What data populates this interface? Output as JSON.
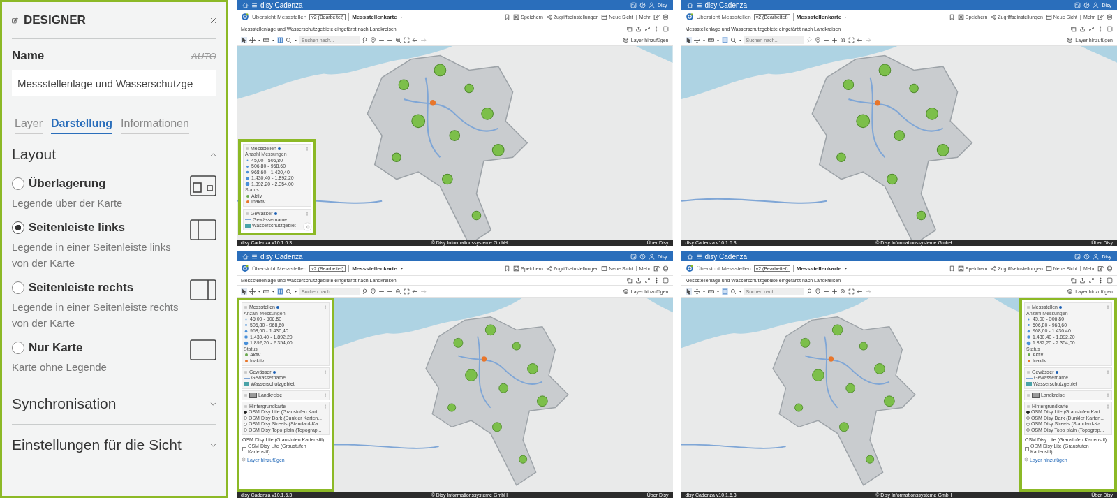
{
  "designer": {
    "title": "DESIGNER",
    "name_label": "Name",
    "auto_label": "AUTO",
    "name_value": "Messstellenlage und Wasserschutzge",
    "tabs": [
      {
        "label": "Layer",
        "selected": false
      },
      {
        "label": "Darstellung",
        "selected": true
      },
      {
        "label": "Informationen",
        "selected": false
      }
    ],
    "sections": [
      {
        "title": "Layout",
        "expanded": true,
        "options": [
          {
            "kind": "overlay",
            "label": "Überlagerung",
            "description": "Legende über der Karte",
            "selected": false
          },
          {
            "kind": "sidebar-left",
            "label": "Seitenleiste links",
            "description": "Legende in einer Seitenleiste links von der Karte",
            "selected": true
          },
          {
            "kind": "sidebar-right",
            "label": "Seitenleiste rechts",
            "description": "Legende in einer Seitenleiste rechts von der Karte",
            "selected": false
          },
          {
            "kind": "map-only",
            "label": "Nur Karte",
            "description": "Karte ohne Legende",
            "selected": false
          }
        ]
      },
      {
        "title": "Synchronisation",
        "expanded": false
      },
      {
        "title": "Einstellungen für die Sicht",
        "expanded": false
      }
    ]
  },
  "screens": [
    {
      "app_name": "disy Cadenza",
      "user": "Disy",
      "breadcrumb": "Übersicht Messstellen",
      "version_badge": "v2 (Bearbeitet)",
      "view_name": "Messstellenkarte",
      "actions": [
        "Speichern",
        "Zugriffseinstellungen",
        "Neue Sicht",
        "Mehr"
      ],
      "map_title": "Messstellenlage und Wasserschutzgebiete eingefärbt nach Landkreisen",
      "search_placeholder": "Suchen nach...",
      "add_layer": "Layer hinzufügen",
      "kind": "overlay",
      "legend": {
        "sections": [
          {
            "kind": "group",
            "title": "Messstellen",
            "indicator": true,
            "swatch": false,
            "items": [
              {
                "kind": "heading",
                "label": "Anzahl Messungen"
              },
              {
                "kind": "size",
                "label": "45,00 - 506,80"
              },
              {
                "kind": "size",
                "label": "506,80 - 968,60"
              },
              {
                "kind": "size",
                "label": "968,60 - 1.430,40"
              },
              {
                "kind": "size",
                "label": "1.430,40 - 1.892,20"
              },
              {
                "kind": "size",
                "label": "1.892,20 - 2.354,00"
              },
              {
                "kind": "heading",
                "label": "Status"
              },
              {
                "kind": "status",
                "label": "Aktiv",
                "color": "#6aa84f"
              },
              {
                "kind": "status",
                "label": "Inaktiv",
                "color": "#e8762b"
              }
            ]
          },
          {
            "kind": "group",
            "title": "Gewässer",
            "indicator": true,
            "swatch": false,
            "items": [
              {
                "kind": "line",
                "label": "Gewässername"
              },
              {
                "kind": "area",
                "label": "Wasserschutzgebiet"
              }
            ]
          }
        ]
      },
      "footer": {
        "left": "disy Cadenza v10.1.6.3",
        "center": "© Disy Informationssysteme GmbH",
        "right": "Über Disy"
      }
    },
    {
      "app_name": "disy Cadenza",
      "user": "Disy",
      "breadcrumb": "Übersicht Messstellen",
      "version_badge": "v2 (Bearbeitet)",
      "view_name": "Messstellenkarte",
      "actions": [
        "Speichern",
        "Zugriffseinstellungen",
        "Neue Sicht",
        "Mehr"
      ],
      "map_title": "Messstellenlage und Wasserschutzgebiete eingefärbt nach Landkreisen",
      "search_placeholder": "Suchen nach...",
      "add_layer": "Layer hinzufügen",
      "kind": "none",
      "footer": {
        "left": "disy Cadenza v10.1.6.3",
        "center": "© Disy Informationssysteme GmbH",
        "right": "Über Disy"
      }
    },
    {
      "app_name": "disy Cadenza",
      "user": "Disy",
      "breadcrumb": "Übersicht Messstellen",
      "version_badge": "v2 (Bearbeitet)",
      "view_name": "Messstellenkarte",
      "actions": [
        "Speichern",
        "Zugriffseinstellungen",
        "Neue Sicht",
        "Mehr"
      ],
      "map_title": "Messstellenlage und Wasserschutzgebiete eingefärbt nach Landkreisen",
      "search_placeholder": "Suchen nach...",
      "add_layer": "Layer hinzufügen",
      "kind": "left",
      "legend": {
        "sections": [
          {
            "kind": "group",
            "title": "Messstellen",
            "indicator": true,
            "swatch": false,
            "items": [
              {
                "kind": "heading",
                "label": "Anzahl Messungen"
              },
              {
                "kind": "size",
                "label": "45,00 - 506,80"
              },
              {
                "kind": "size",
                "label": "506,80 - 968,60"
              },
              {
                "kind": "size",
                "label": "968,60 - 1.430,40"
              },
              {
                "kind": "size",
                "label": "1.430,40 - 1.892,20"
              },
              {
                "kind": "size",
                "label": "1.892,20 - 2.354,00"
              },
              {
                "kind": "heading",
                "label": "Status"
              },
              {
                "kind": "status",
                "label": "Aktiv",
                "color": "#6aa84f"
              },
              {
                "kind": "status",
                "label": "Inaktiv",
                "color": "#e8762b"
              }
            ]
          },
          {
            "kind": "group",
            "title": "Gewässer",
            "indicator": true,
            "swatch": false,
            "items": [
              {
                "kind": "line",
                "label": "Gewässername"
              },
              {
                "kind": "area",
                "label": "Wasserschutzgebiet"
              }
            ]
          },
          {
            "kind": "group",
            "title": "Landkreise",
            "indicator": false,
            "swatch": true
          },
          {
            "kind": "group",
            "title": "Hintergrundkarte",
            "indicator": false,
            "swatch": false,
            "items": [
              {
                "kind": "radio",
                "label": "OSM Disy Lite (Graustufen Kart...",
                "selected": true
              },
              {
                "kind": "radio",
                "label": "OSM Disy Dark (Dunkler Karten...",
                "selected": false
              },
              {
                "kind": "radio",
                "label": "OSM Disy Streets (Standard-Ka...",
                "selected": false
              },
              {
                "kind": "radio",
                "label": "OSM Disy Topo plain (Topograp...",
                "selected": false
              }
            ]
          },
          {
            "kind": "plain",
            "title": "OSM Disy Lite (Graustufen Kartenstil)",
            "items": [
              {
                "kind": "checkbox",
                "label": "OSM Disy Lite (Graustufen Kartenstil)",
                "checked": false
              }
            ]
          }
        ],
        "link": "Layer hinzufügen"
      },
      "footer": {
        "left": "disy Cadenza v10.1.6.3",
        "center": "© Disy Informationssysteme GmbH",
        "right": "Über Disy"
      }
    },
    {
      "app_name": "disy Cadenza",
      "user": "Disy",
      "breadcrumb": "Übersicht Messstellen",
      "version_badge": "v2 (Bearbeitet)",
      "view_name": "Messstellenkarte",
      "actions": [
        "Speichern",
        "Zugriffseinstellungen",
        "Neue Sicht",
        "Mehr"
      ],
      "map_title": "Messstellenlage und Wasserschutzgebiete eingefärbt nach Landkreisen",
      "search_placeholder": "Suchen nach...",
      "add_layer": "Layer hinzufügen",
      "kind": "right",
      "legend": {
        "sections": [
          {
            "kind": "group",
            "title": "Messstellen",
            "indicator": true,
            "swatch": false,
            "items": [
              {
                "kind": "heading",
                "label": "Anzahl Messungen"
              },
              {
                "kind": "size",
                "label": "45,00 - 506,80"
              },
              {
                "kind": "size",
                "label": "506,80 - 968,60"
              },
              {
                "kind": "size",
                "label": "968,60 - 1.430,40"
              },
              {
                "kind": "size",
                "label": "1.430,40 - 1.892,20"
              },
              {
                "kind": "size",
                "label": "1.892,20 - 2.354,00"
              },
              {
                "kind": "heading",
                "label": "Status"
              },
              {
                "kind": "status",
                "label": "Aktiv",
                "color": "#6aa84f"
              },
              {
                "kind": "status",
                "label": "Inaktiv",
                "color": "#e8762b"
              }
            ]
          },
          {
            "kind": "group",
            "title": "Gewässer",
            "indicator": true,
            "swatch": false,
            "items": [
              {
                "kind": "line",
                "label": "Gewässername"
              },
              {
                "kind": "area",
                "label": "Wasserschutzgebiet"
              }
            ]
          },
          {
            "kind": "group",
            "title": "Landkreise",
            "indicator": false,
            "swatch": true
          },
          {
            "kind": "group",
            "title": "Hintergrundkarte",
            "indicator": false,
            "swatch": false,
            "items": [
              {
                "kind": "radio",
                "label": "OSM Disy Lite (Graustufen Kart...",
                "selected": true
              },
              {
                "kind": "radio",
                "label": "OSM Disy Dark (Dunkler Karten...",
                "selected": false
              },
              {
                "kind": "radio",
                "label": "OSM Disy Streets (Standard-Ka...",
                "selected": false
              },
              {
                "kind": "radio",
                "label": "OSM Disy Topo plain (Topograp...",
                "selected": false
              }
            ]
          },
          {
            "kind": "plain",
            "title": "OSM Disy Lite (Graustufen Kartenstil)",
            "items": [
              {
                "kind": "checkbox",
                "label": "OSM Disy Lite (Graustufen Kartenstil)",
                "checked": false
              }
            ]
          }
        ],
        "link": "Layer hinzufügen"
      },
      "footer": {
        "left": "disy Cadenza v10.1.6.3",
        "center": "© Disy Informationssysteme GmbH",
        "right": "Über Disy"
      }
    }
  ]
}
